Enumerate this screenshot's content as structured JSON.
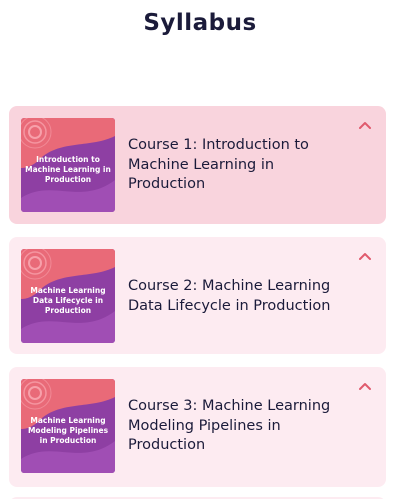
{
  "page": {
    "title": "Syllabus"
  },
  "courses": [
    {
      "title": "Course 1: Introduction to Machine Learning in Production",
      "thumbnail_text": "Introduction to Machine Learning in Production",
      "expanded": true,
      "icon": "chevron-up-icon"
    },
    {
      "title": "Course 2: Machine Learning Data Lifecycle in Production",
      "thumbnail_text": "Machine Learning Data Lifecycle in Production",
      "expanded": true,
      "icon": "chevron-up-icon"
    },
    {
      "title": "Course 3: Machine Learning Modeling Pipelines in Production",
      "thumbnail_text": "Machine Learning Modeling Pipelines in Production",
      "expanded": true,
      "icon": "chevron-up-icon"
    }
  ],
  "colors": {
    "active_card": "#f9d4dd",
    "card": "#fdebf1",
    "accent": "#e05a6d",
    "thumbnail_purple": "#8e3fa3",
    "thumbnail_coral": "#e96a78",
    "title_text": "#1b1b3a"
  }
}
